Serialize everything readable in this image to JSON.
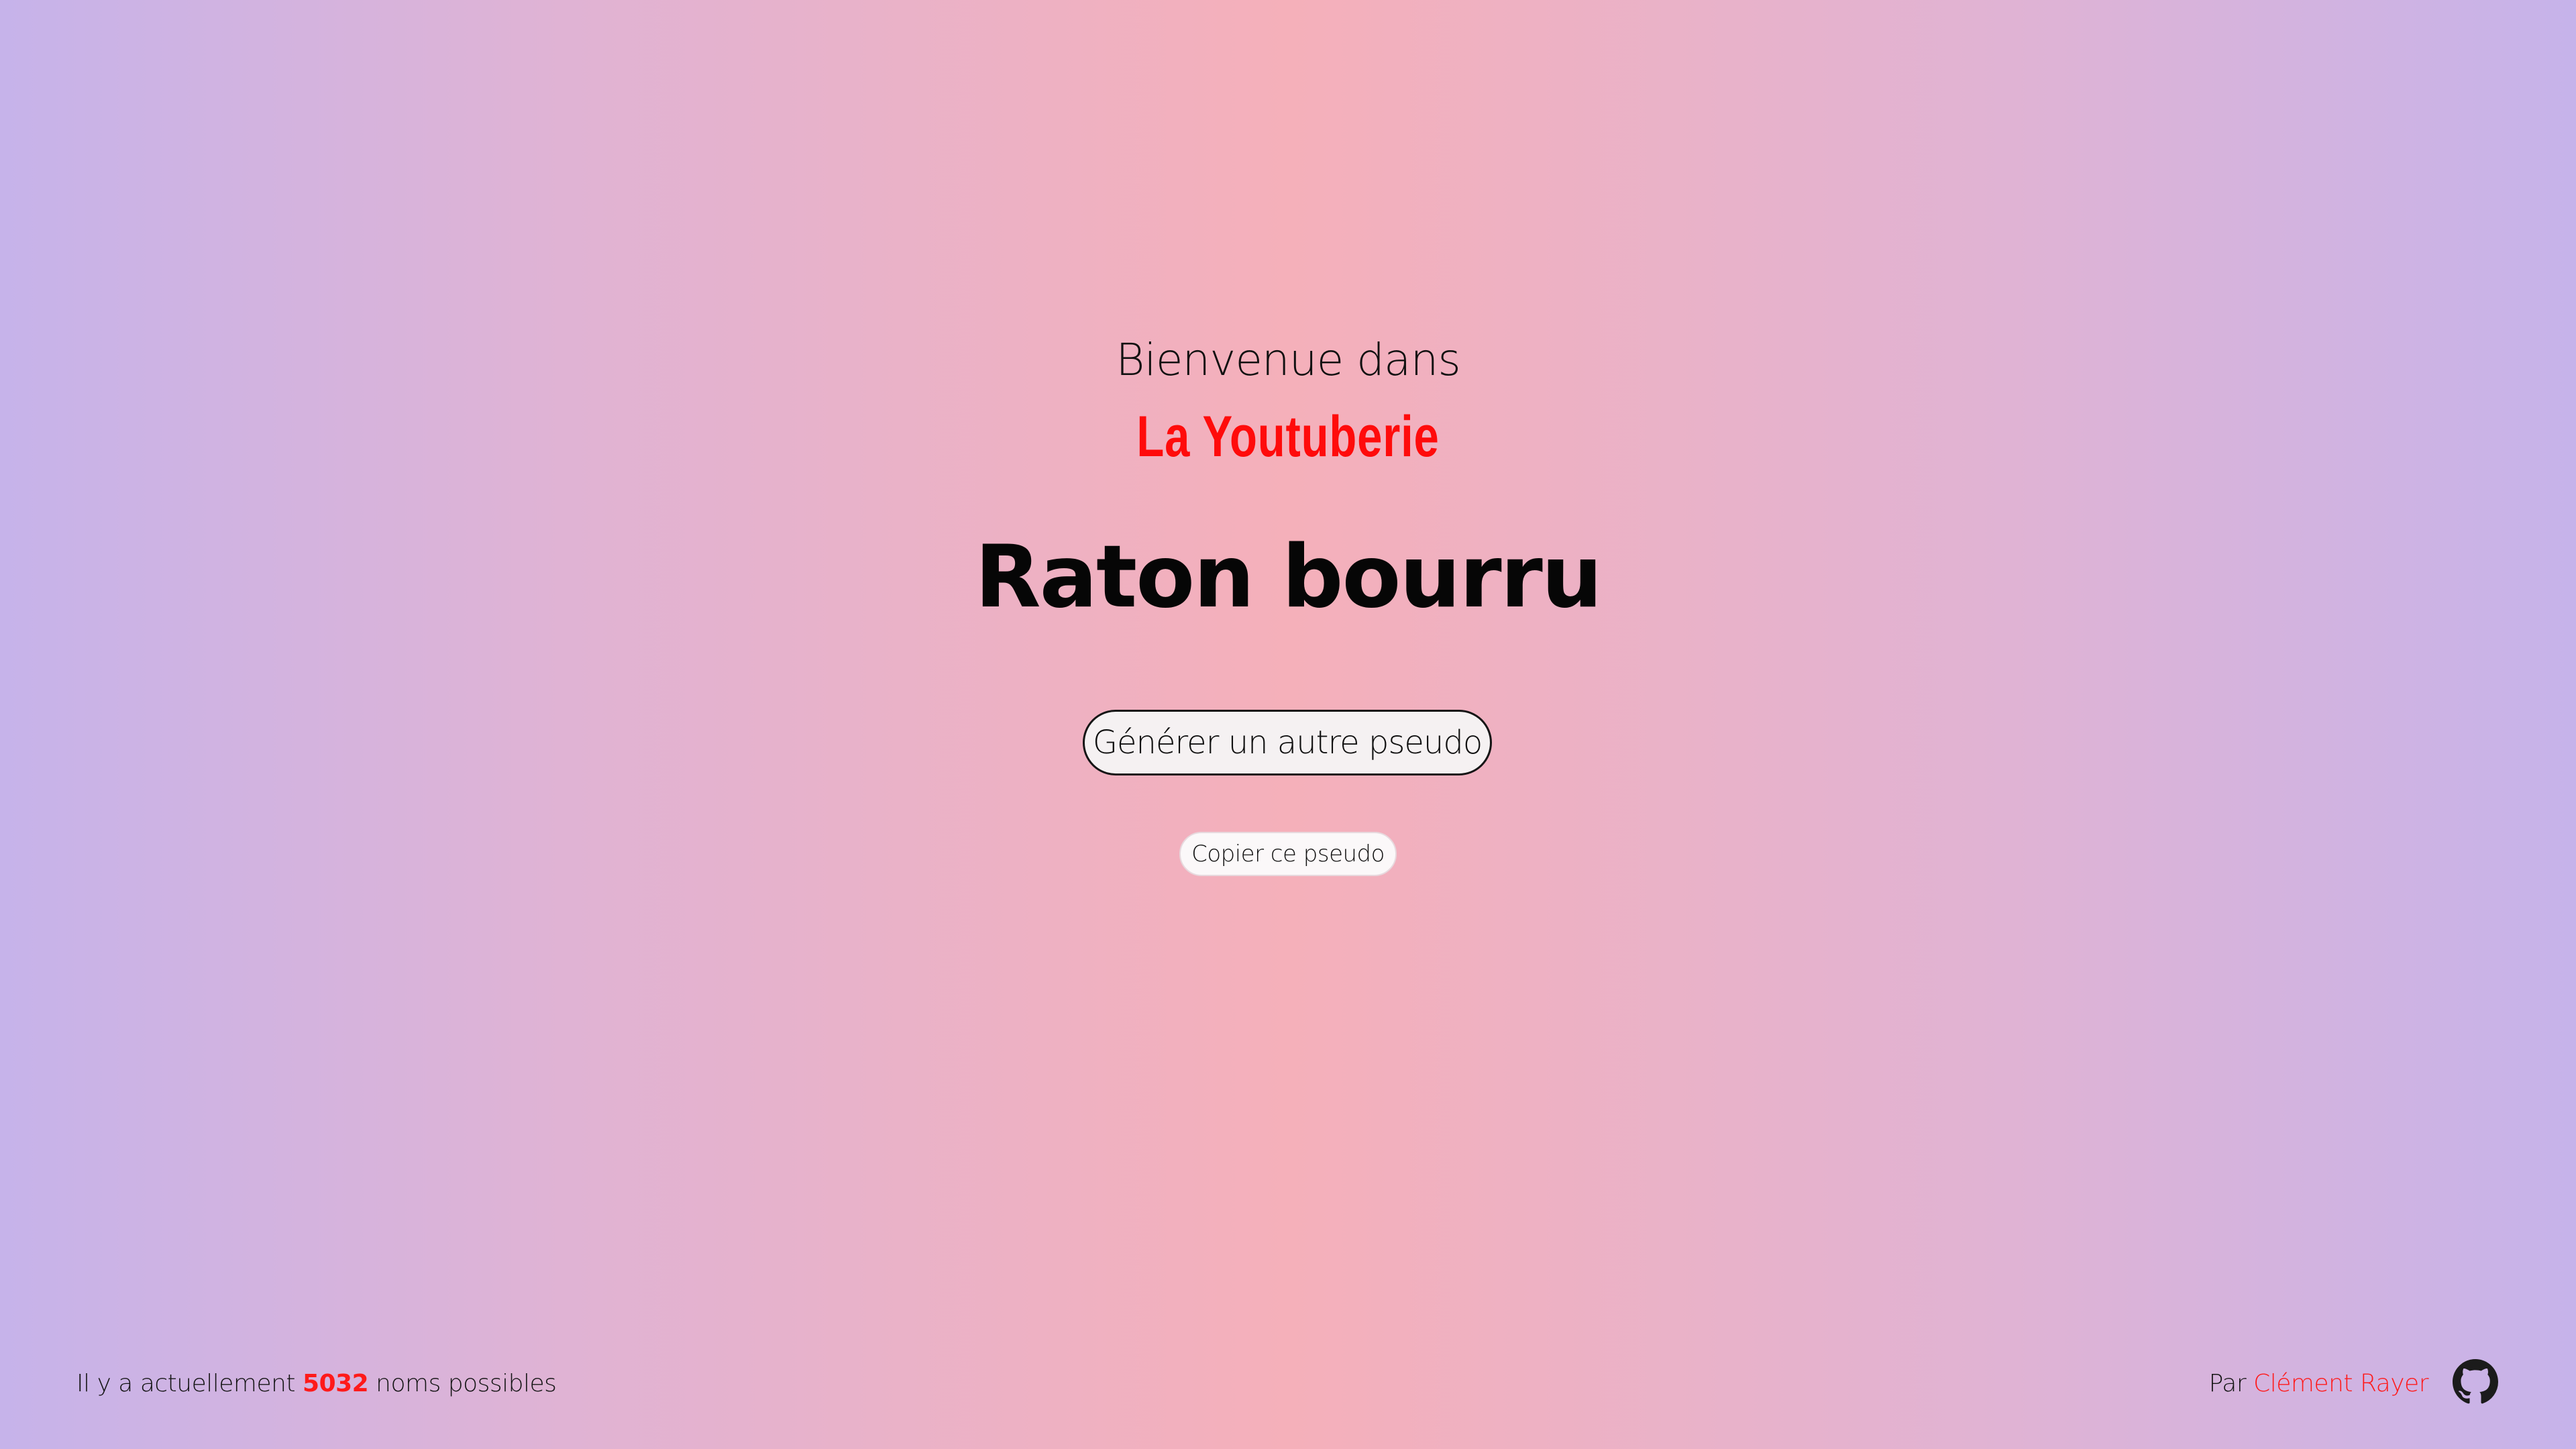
{
  "header": {
    "welcome": "Bienvenue dans",
    "brand": "La Youtuberie"
  },
  "main": {
    "pseudo": "Raton bourru",
    "generate_button": "Générer un autre pseudo",
    "copy_button": "Copier ce pseudo"
  },
  "footer": {
    "count_prefix": "Il y a actuellement",
    "count_value": "5032",
    "count_suffix": "noms possibles",
    "author_prefix": "Par",
    "author_name": "Clément Rayer",
    "github_icon": "github-icon"
  },
  "colors": {
    "accent": "#ff0b0b",
    "gradient_edge": "#c6b3ea",
    "gradient_center": "#f5b0ba"
  }
}
